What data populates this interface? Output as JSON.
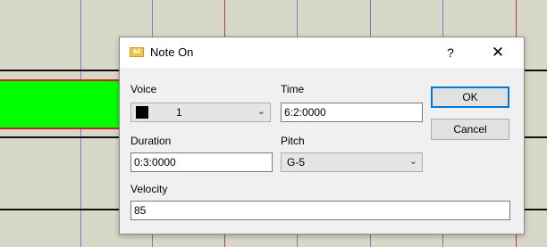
{
  "dialog": {
    "title": "Note On",
    "app_icon": "piano-roll-app-icon",
    "app_icon_text": "64",
    "help_glyph": "?",
    "close_glyph": "✕"
  },
  "fields": {
    "voice": {
      "label": "Voice",
      "value": "1",
      "swatch_color": "#000000"
    },
    "time": {
      "label": "Time",
      "value": "6:2:0000"
    },
    "duration": {
      "label": "Duration",
      "value": "0:3:0000"
    },
    "pitch": {
      "label": "Pitch",
      "value": "G-5"
    },
    "velocity": {
      "label": "Velocity",
      "value": "85"
    }
  },
  "buttons": {
    "ok": "OK",
    "cancel": "Cancel"
  },
  "colors": {
    "note": "#00ff00",
    "note_border": "#cc2222",
    "default_button_border": "#0078d7"
  },
  "icons": {
    "dropdown": "chevron-down-icon",
    "close": "close-icon",
    "help": "help-icon"
  }
}
